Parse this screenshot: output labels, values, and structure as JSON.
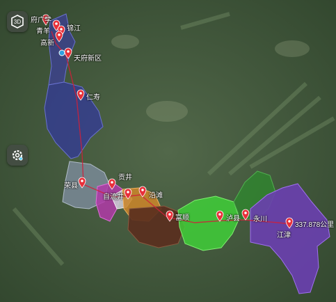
{
  "controls": {
    "view_3d_icon": "3d-view-icon",
    "settings_icon": "gear-icon"
  },
  "route": {
    "color": "#d0203a",
    "distance_label": "337.878公里"
  },
  "places": {
    "fuhuaxue": "府广学",
    "qingyang": "青羊",
    "jinjiang": "锦江",
    "gaoxin": "高新",
    "tianfu": "天府新区",
    "renshou": "仁寿",
    "rongxian": "荣县",
    "gongjing": "贡井",
    "ziliujing": "自流井",
    "yantan": "沿滩",
    "fushun": "富顺",
    "luxian": "泸县",
    "yongchuan": "永川",
    "jiangjin": "江津"
  },
  "region_colors": {
    "chengdu": "#3b3f9a",
    "renshou": "#33399a",
    "rongxian": "#7a8a98",
    "gongjing": "#b23aa8",
    "ziliujing": "#c8c8d0",
    "yantan": "#c9852a",
    "fushun": "#5a2f1e",
    "luxian": "#3fcf38",
    "yongchuan": "#2d8a2d",
    "jiangjin": "#6a3fb0"
  }
}
